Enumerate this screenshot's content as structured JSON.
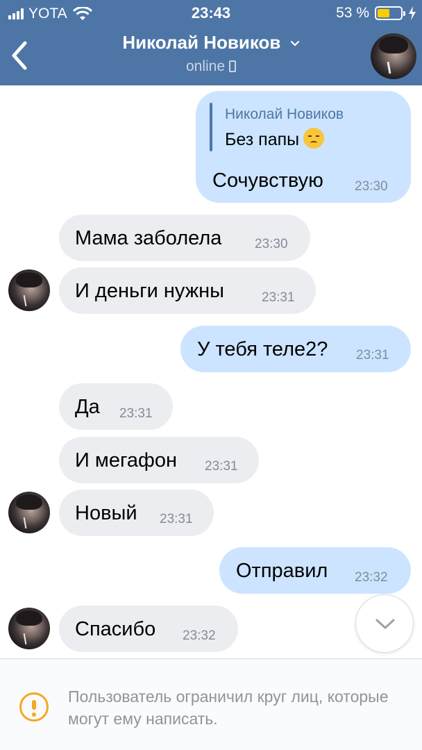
{
  "status_bar": {
    "carrier": "YOTA",
    "time": "23:43",
    "battery": "53 %",
    "battery_level": 0.53
  },
  "nav": {
    "title": "Николай Новиков",
    "status": "online"
  },
  "reply": {
    "author": "Николай Новиков",
    "text": "Без папы"
  },
  "messages": [
    {
      "direction": "out",
      "text": "Сочувствую",
      "time": "23:30"
    },
    {
      "direction": "in",
      "text": "Мама заболела",
      "time": "23:30"
    },
    {
      "direction": "in",
      "text": "И деньги нужны",
      "time": "23:31"
    },
    {
      "direction": "out",
      "text": "У тебя теле2?",
      "time": "23:31"
    },
    {
      "direction": "in",
      "text": "Да",
      "time": "23:31"
    },
    {
      "direction": "in",
      "text": "И мегафон",
      "time": "23:31"
    },
    {
      "direction": "in",
      "text": "Новый",
      "time": "23:31"
    },
    {
      "direction": "out",
      "text": "Отправил",
      "time": "23:32"
    },
    {
      "direction": "in",
      "text": "Спасибо",
      "time": "23:32"
    }
  ],
  "footer": {
    "notice": "Пользователь ограничил круг лиц, которые могут ему написать."
  },
  "colors": {
    "header": "#4d76a6",
    "outgoing": "#cce4ff",
    "incoming": "#ebedf0",
    "warning": "#f5a623"
  },
  "icons": [
    "signal-icon",
    "wifi-icon",
    "battery-icon",
    "charging-icon",
    "back-chevron-icon",
    "dropdown-chevron-icon",
    "mobile-icon",
    "pensive-face-emoji",
    "chevron-down-icon",
    "warning-icon"
  ]
}
